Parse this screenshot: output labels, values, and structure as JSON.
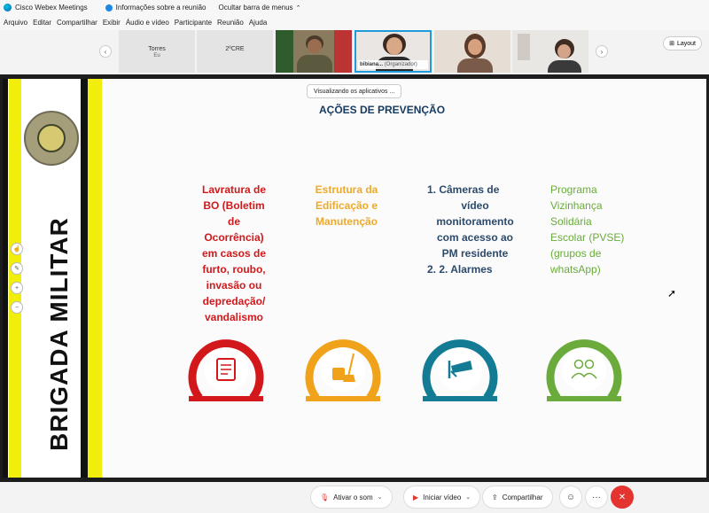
{
  "titlebar": {
    "app_title": "Cisco Webex Meetings",
    "meeting_info": "Informações sobre a reunião",
    "hide_menu": "Ocultar barra de menus"
  },
  "menu": [
    "Arquivo",
    "Editar",
    "Compartilhar",
    "Exibir",
    "Áudio e vídeo",
    "Participante",
    "Reunião",
    "Ajuda"
  ],
  "participants": [
    {
      "name": "Torres",
      "sub": "Eu"
    },
    {
      "name": "2ºCRE",
      "sub": ""
    },
    {
      "name": "",
      "sub": ""
    },
    {
      "name": "bibiana...",
      "role": "(Organizador)"
    },
    {
      "name": "",
      "sub": ""
    },
    {
      "name": "",
      "sub": ""
    }
  ],
  "layout_button": "Layout",
  "viewing_banner": "Visualizando os aplicativos ...",
  "slide": {
    "side_text": "BRIGADA MILITAR",
    "title": "AÇÕES DE PREVENÇÃO",
    "col_red": [
      "Lavratura de",
      "BO (Boletim",
      "de",
      "Ocorrência)",
      "em casos de",
      "furto, roubo,",
      "invasão ou",
      "depredação/",
      "vandalismo"
    ],
    "col_orange": [
      "Estrutura da",
      "Edificação e",
      "Manutenção"
    ],
    "col_blue": [
      "1.   Câmeras de",
      "vídeo",
      "monitoramento",
      "com acesso ao",
      "PM residente",
      "2.   2. Alarmes"
    ],
    "col_green": [
      "Programa",
      "Vizinhança",
      "Solidária",
      "Escolar (PVSE)",
      "(grupos de",
      "whatsApp)"
    ],
    "colors": {
      "red": "#d3181b",
      "orange": "#f0a21b",
      "blue": "#147b95",
      "green": "#6aab3b",
      "title": "#153a5f"
    }
  },
  "controls": {
    "mute": "Ativar o som",
    "video": "Iniciar vídeo",
    "share": "Compartilhar"
  },
  "icons": [
    "webex-icon",
    "info-icon",
    "chevron-up-icon",
    "chevron-left-icon",
    "chevron-right-icon",
    "layout-icon",
    "microphone-muted-icon",
    "video-icon",
    "share-icon",
    "reactions-icon",
    "more-icon",
    "end-call-icon"
  ]
}
